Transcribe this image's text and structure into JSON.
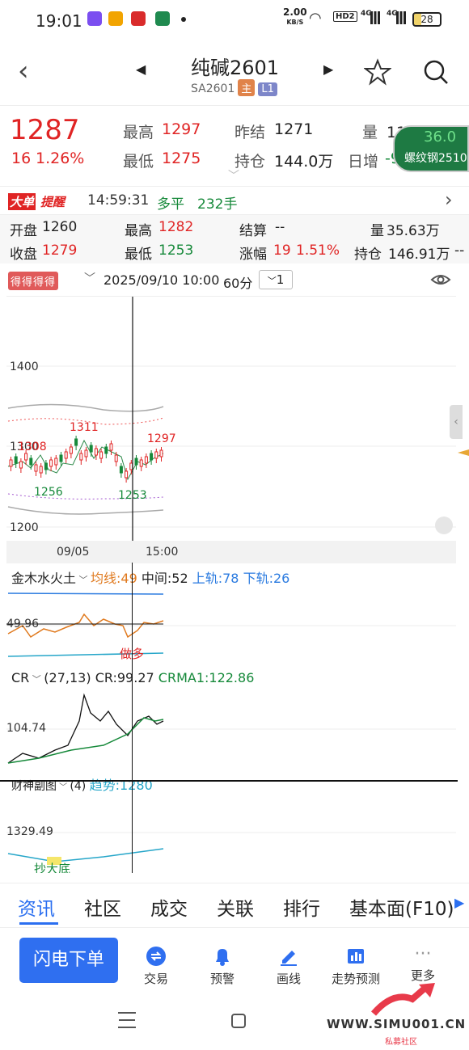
{
  "status": {
    "time": "19:01",
    "speed": "2.00",
    "speed_unit": "KB/S",
    "battery": "28",
    "net1": "4G",
    "net2": "4G",
    "hd": "HD2"
  },
  "header": {
    "title": "纯碱2601",
    "code": "SA2601",
    "tag_main": "主",
    "tag_l1": "L1"
  },
  "quote": {
    "price": "1287",
    "change": "16",
    "change_pct": "1.26%",
    "high_label": "最高",
    "high": "1297",
    "low_label": "最低",
    "low": "1275",
    "prev_label": "昨结",
    "prev": "1271",
    "oi_label": "持仓",
    "oi": "144.0万",
    "vol_label": "量",
    "vol": "110.24万",
    "daily_label": "日增",
    "daily": "-9",
    "float_value": "36.0",
    "float_name": "螺纹钢2510"
  },
  "notice": {
    "badge1": "大单",
    "badge2": "提醒",
    "time": "14:59:31",
    "action": "多平",
    "qty": "232手"
  },
  "stats": {
    "open_label": "开盘",
    "open": "1260",
    "high_label": "最高",
    "high": "1282",
    "settle_label": "结算",
    "settle": "--",
    "vol_label": "量",
    "vol": "35.63万",
    "close_label": "收盘",
    "close": "1279",
    "low_label": "最低",
    "low": "1253",
    "chg_label": "涨幅",
    "chg": "19",
    "chg_pct": "1.51%",
    "oi_label": "持仓",
    "oi": "146.91万",
    "extra": "--"
  },
  "toolbar": {
    "indicator": "得得得得",
    "datetime": "2025/09/10 10:00",
    "period": "60分",
    "count": "1"
  },
  "main_chart": {
    "y_labels": [
      "1400",
      "1300",
      "1200"
    ],
    "overlap_label": "1308",
    "ann_high": "1311",
    "ann_low": "1256",
    "ann_low2": "1253",
    "ann_last": "1297",
    "x_labels": [
      "09/05",
      "15:00"
    ]
  },
  "ind1": {
    "name": "金木水火土",
    "ma_label": "均线:49",
    "mid_label": "中间:52",
    "up_label": "上轨:78",
    "down_label": "下轨:26",
    "value": "49.96",
    "signal": "做多"
  },
  "ind2": {
    "name": "CR",
    "params": "(27,13)",
    "cr": "CR:99.27",
    "crma": "CRMA1:122.86",
    "value": "104.74"
  },
  "ind3": {
    "name": "财神副图",
    "params": "(4)",
    "trend": "趋势:1280",
    "value": "1329.49",
    "signal": "抄大底"
  },
  "tabs": [
    "资讯",
    "社区",
    "成交",
    "关联",
    "排行",
    "基本面(F10)"
  ],
  "bottom": {
    "flash_order": "闪电下单",
    "items": [
      "交易",
      "预警",
      "画线",
      "走势预测",
      "更多"
    ]
  },
  "watermark": {
    "site": "WWW.SIMU001.CN",
    "sub": "私募社区"
  },
  "colors": {
    "up": "#e02424",
    "down": "#16893a",
    "accent": "#2b6ff0",
    "orange": "#e07a1f",
    "cyan": "#26a6c9"
  }
}
